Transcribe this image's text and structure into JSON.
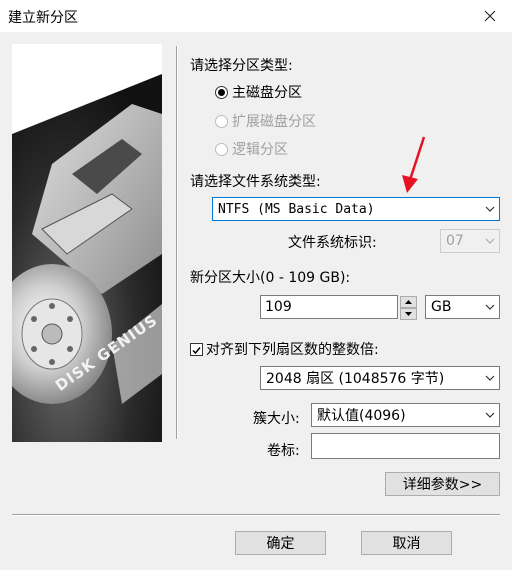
{
  "window": {
    "title": "建立新分区"
  },
  "partition_type": {
    "heading": "请选择分区类型:",
    "options": [
      {
        "label": "主磁盘分区",
        "checked": true,
        "enabled": true
      },
      {
        "label": "扩展磁盘分区",
        "checked": false,
        "enabled": false
      },
      {
        "label": "逻辑分区",
        "checked": false,
        "enabled": false
      }
    ]
  },
  "filesystem": {
    "heading": "请选择文件系统类型:",
    "selected": "NTFS (MS Basic Data)",
    "id_label": "文件系统标识:",
    "id_value": "07"
  },
  "size": {
    "label": "新分区大小(0 - 109 GB):",
    "value": "109",
    "unit": "GB"
  },
  "align": {
    "label": "对齐到下列扇区数的整数倍:",
    "checked": true,
    "value": "2048 扇区 (1048576 字节)"
  },
  "cluster": {
    "label": "簇大小:",
    "value": "默认值(4096)"
  },
  "volume": {
    "label": "卷标:",
    "value": ""
  },
  "buttons": {
    "details": "详细参数>>",
    "ok": "确定",
    "cancel": "取消"
  },
  "logo_text": "DISK GENIUS",
  "colors": {
    "annotation_arrow": "#e81123",
    "focus_border": "#0078d7"
  }
}
